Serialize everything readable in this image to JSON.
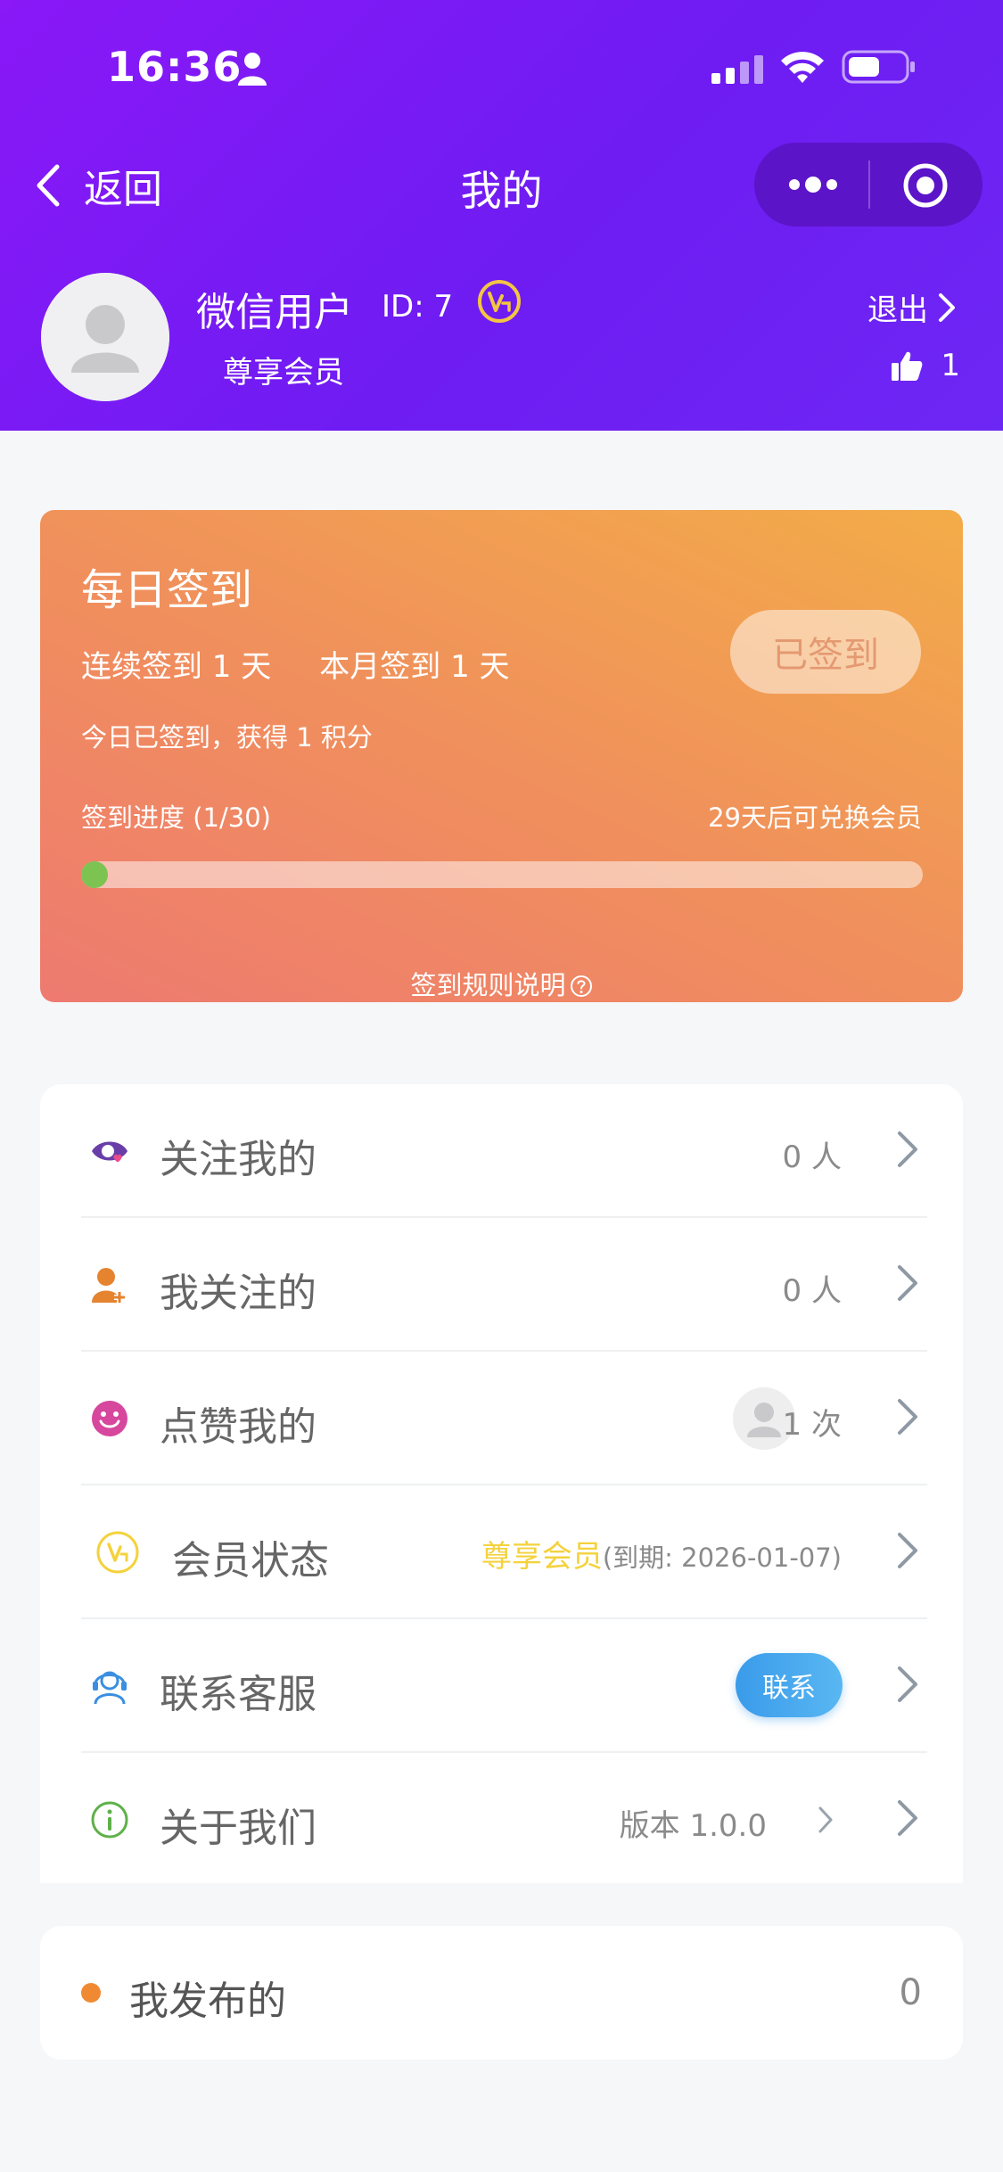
{
  "status_bar": {
    "time": "16:36"
  },
  "nav": {
    "back_label": "返回",
    "title": "我的"
  },
  "profile": {
    "nickname": "微信用户",
    "id_text": "ID: 7",
    "member_tier": "尊享会员",
    "logout_label": "退出",
    "likes_count": "1"
  },
  "sign_in": {
    "title": "每日签到",
    "streak_text": "连续签到 1 天     本月签到 1 天",
    "today_message": "今日已签到，获得 1 积分",
    "button_label": "已签到",
    "progress_label": "签到进度 (1/30)",
    "progress_tip": "29天后可兑换会员",
    "progress_fraction": 0.0333,
    "rules_link": "签到规则说明"
  },
  "menu": {
    "followers": {
      "label": "关注我的",
      "value": "0 人"
    },
    "following": {
      "label": "我关注的",
      "value": "0 人"
    },
    "liked_me": {
      "label": "点赞我的",
      "value": "1 次"
    },
    "membership": {
      "label": "会员状态",
      "tier": "尊享会员",
      "expiry": "(到期: 2026-01-07)"
    },
    "support": {
      "label": "联系客服",
      "button": "联系"
    },
    "about": {
      "label": "关于我们",
      "value": "版本 1.0.0"
    }
  },
  "published": {
    "label": "我发布的",
    "count": "0"
  },
  "colors": {
    "header_gradient": [
      "#8a18f7",
      "#6d27f4"
    ],
    "sign_card_gradient": [
      "#ee7a70",
      "#f3ac48"
    ],
    "progress_dot": "#7dc352",
    "tier_yellow": "#f4d23c",
    "contact_blue": "#3a9bea",
    "published_dot": "#f08a32"
  },
  "icons": [
    "person-icon",
    "signal-icon",
    "wifi-icon",
    "battery-icon",
    "chevron-left-icon",
    "more-icon",
    "target-icon",
    "vip-badge-icon",
    "thumbs-up-icon",
    "eye-heart-icon",
    "user-plus-icon",
    "smile-icon",
    "vip-icon",
    "headset-icon",
    "info-icon",
    "chevron-right-icon"
  ]
}
